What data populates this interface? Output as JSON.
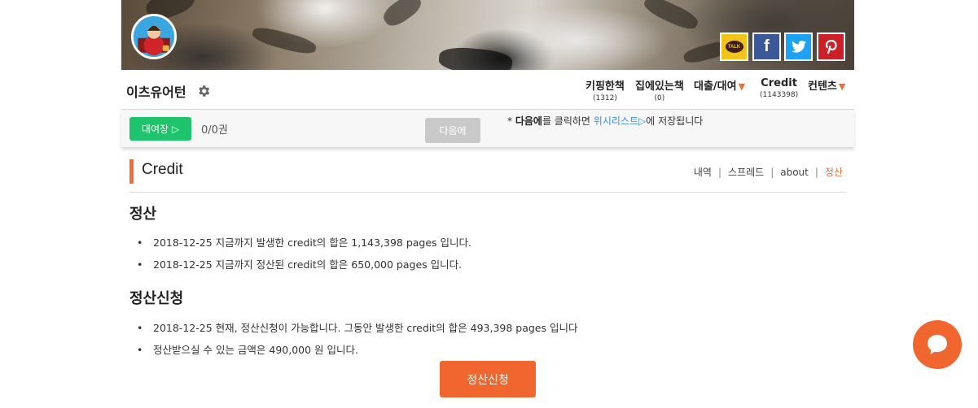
{
  "header": {
    "social": {
      "talk": "TALK",
      "facebook": "f"
    }
  },
  "nav": {
    "site_title": "이츠유어턴",
    "items": [
      {
        "label": "키핑한책",
        "count": "(1312)"
      },
      {
        "label": "집에있는책",
        "count": "(0)"
      },
      {
        "label": "대출/대여"
      },
      {
        "label": "Credit",
        "count": "(1143398)"
      },
      {
        "label": "컨텐츠"
      }
    ]
  },
  "rental": {
    "button_label": "대여장 ▷",
    "count": "0/0권",
    "next_label": "다음에",
    "notice": {
      "prefix": "* ",
      "bold": "다음에",
      "mid": "를 클릭하면 ",
      "link": "위시리스트▷",
      "suffix": "에 저장됩니다"
    }
  },
  "credit": {
    "title": "Credit",
    "subnav": [
      "내역",
      "스프레드",
      "about",
      "정산"
    ],
    "active_tab": "정산"
  },
  "settlement": {
    "heading": "정산",
    "items": [
      "2018-12-25 지금까지 발생한 credit의 합은 1,143,398 pages 입니다.",
      "2018-12-25 지금까지 정산된 credit의 합은 650,000 pages 입니다."
    ]
  },
  "request": {
    "heading": "정산신청",
    "items": [
      "2018-12-25 현재, 정산신청이 가능합니다. 그동안 발생한 credit의 합은 493,398 pages 입니다",
      "정산받으실 수 있는 금액은 490,000 원 입니다."
    ],
    "button_label": "정산신청"
  },
  "colors": {
    "accent": "#f06d35",
    "green": "#1dc46b",
    "link": "#3d8fe0"
  }
}
